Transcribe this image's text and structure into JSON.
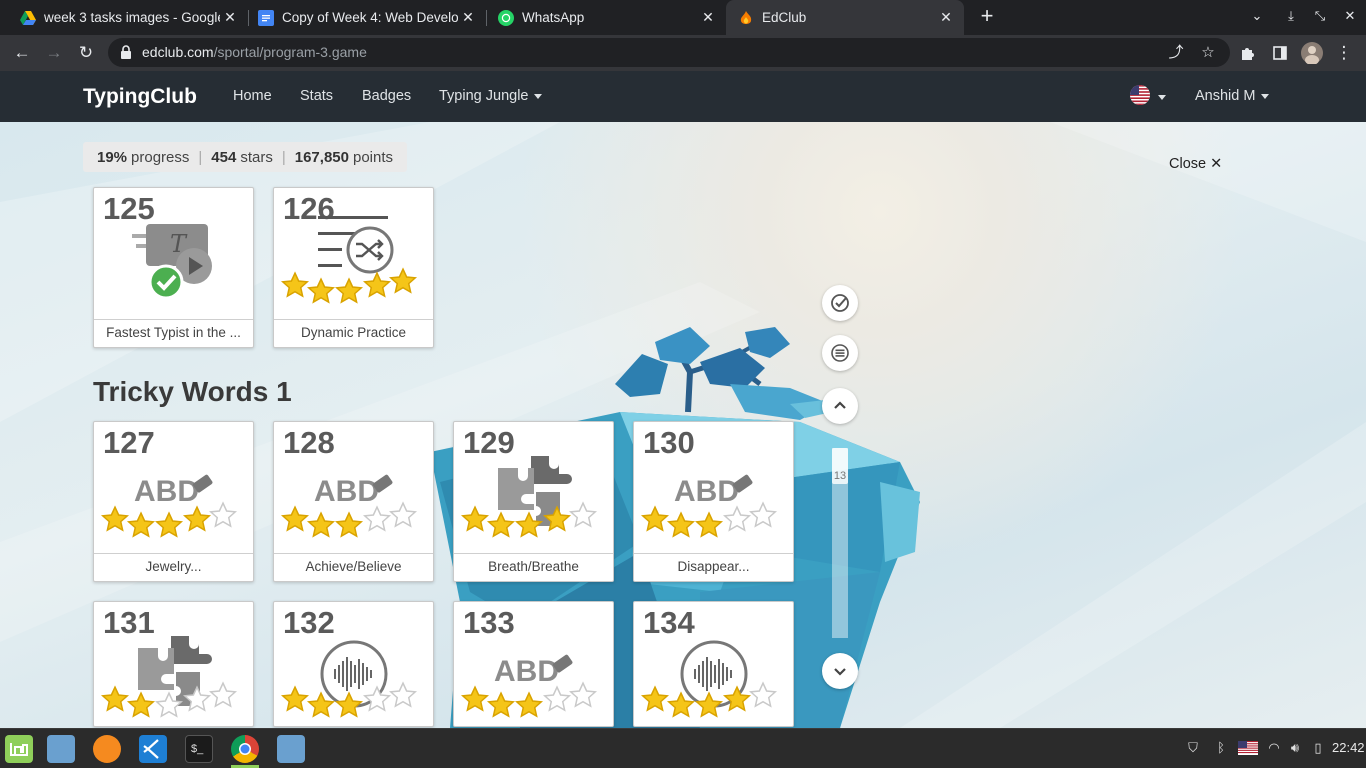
{
  "browser": {
    "tabs": [
      {
        "title": "week 3 tasks images - Google",
        "icon": "google-drive-icon",
        "active": false
      },
      {
        "title": "Copy of Week 4: Web Develop",
        "icon": "google-docs-icon",
        "active": false
      },
      {
        "title": "WhatsApp",
        "icon": "whatsapp-icon",
        "active": false
      },
      {
        "title": "EdClub",
        "icon": "edclub-icon",
        "active": true
      }
    ],
    "url_host": "edclub.com",
    "url_path": "/sportal/program-3.game"
  },
  "site": {
    "brand": "TypingClub",
    "nav": {
      "home": "Home",
      "stats": "Stats",
      "badges": "Badges",
      "program": "Typing Jungle"
    },
    "user": "Anshid M",
    "language_flag": "us-flag"
  },
  "stats": {
    "progress_value": "19%",
    "progress_label": "progress",
    "stars_value": "454",
    "stars_label": "stars",
    "points_value": "167,850",
    "points_label": "points"
  },
  "close_label": "Close",
  "section_title": "Tricky Words 1",
  "lessons": [
    {
      "num": "125",
      "name": "Fastest Typist in the ...",
      "art": "video-complete",
      "stars": 0
    },
    {
      "num": "126",
      "name": "Dynamic Practice",
      "art": "shuffle",
      "stars": 5
    },
    {
      "num": "127",
      "name": "Jewelry...",
      "art": "abc",
      "stars": 4
    },
    {
      "num": "128",
      "name": "Achieve/Believe",
      "art": "abc",
      "stars": 3
    },
    {
      "num": "129",
      "name": "Breath/Breathe",
      "art": "puzzle",
      "stars": 4
    },
    {
      "num": "130",
      "name": "Disappear...",
      "art": "abc",
      "stars": 3
    },
    {
      "num": "131",
      "name": "",
      "art": "puzzle",
      "stars": 2
    },
    {
      "num": "132",
      "name": "",
      "art": "audio",
      "stars": 3
    },
    {
      "num": "133",
      "name": "",
      "art": "abc",
      "stars": 3
    },
    {
      "num": "134",
      "name": "",
      "art": "audio",
      "stars": 4
    }
  ],
  "scroll_indicator": "13",
  "taskbar": {
    "time": "22:42"
  },
  "colors": {
    "navbar": "#262d34",
    "star_gold": "#f5c518",
    "tab_bg": "#202124"
  }
}
